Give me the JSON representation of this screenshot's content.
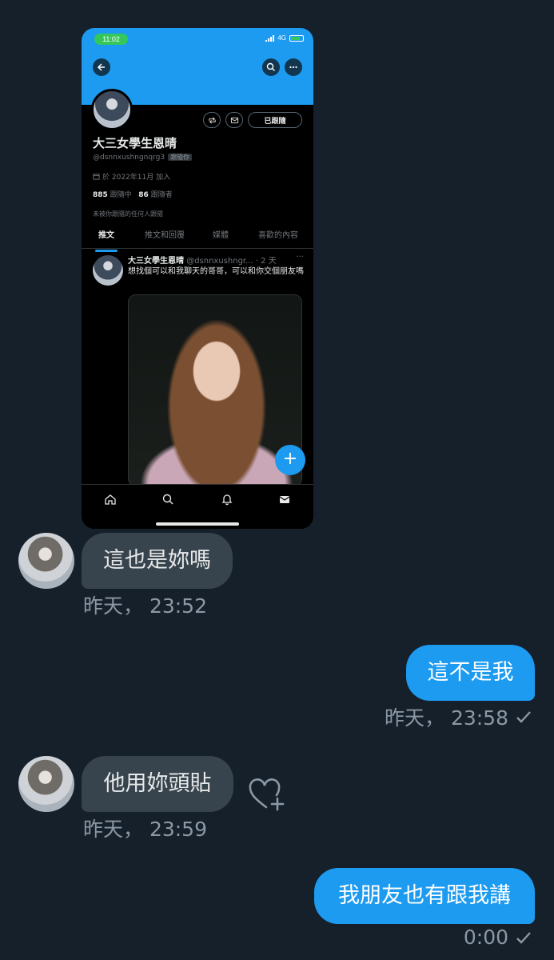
{
  "screenshot": {
    "status_bar": {
      "time": "11:02",
      "network": "4G"
    },
    "profile": {
      "name": "大三女學生恩晴",
      "handle": "@dsnnxushngnqrg3",
      "follows_you_badge": "跟隨你",
      "joined": "於 2022年11月 加入",
      "following_count": "885",
      "following_label": "跟隨中",
      "followers_count": "86",
      "followers_label": "跟隨者",
      "note": "未被你跟隨的任何人跟隨",
      "following_button": "已跟隨"
    },
    "tabs": [
      "推文",
      "推文和回覆",
      "媒體",
      "喜歡的內容"
    ],
    "tweet": {
      "author": "大三女學生恩晴",
      "handle": "@dsnnxushngr...",
      "time": "· 2 天",
      "more": "···",
      "text": "想找個可以和我聊天的哥哥，可以和你交個朋友嗎"
    },
    "fab_label": "+"
  },
  "messages": [
    {
      "direction": "in",
      "text": "這也是妳嗎",
      "timestamp": "昨天， 23:52"
    },
    {
      "direction": "out",
      "text": "這不是我",
      "timestamp": "昨天， 23:58",
      "read": true
    },
    {
      "direction": "in",
      "text": "他用妳頭貼",
      "timestamp": "昨天， 23:59"
    },
    {
      "direction": "out",
      "text": "我朋友也有跟我講",
      "timestamp": "0:00",
      "read": true
    }
  ],
  "colors": {
    "background": "#15202b",
    "incoming_bubble": "#38444d",
    "outgoing_bubble": "#1d9bf0",
    "accent": "#1d9bf0"
  },
  "icons": [
    "back-arrow-icon",
    "search-icon",
    "more-icon",
    "retweet-notify-icon",
    "mail-icon",
    "calendar-icon",
    "home-icon",
    "bell-icon",
    "heart-plus-icon",
    "checkmark-icon"
  ]
}
